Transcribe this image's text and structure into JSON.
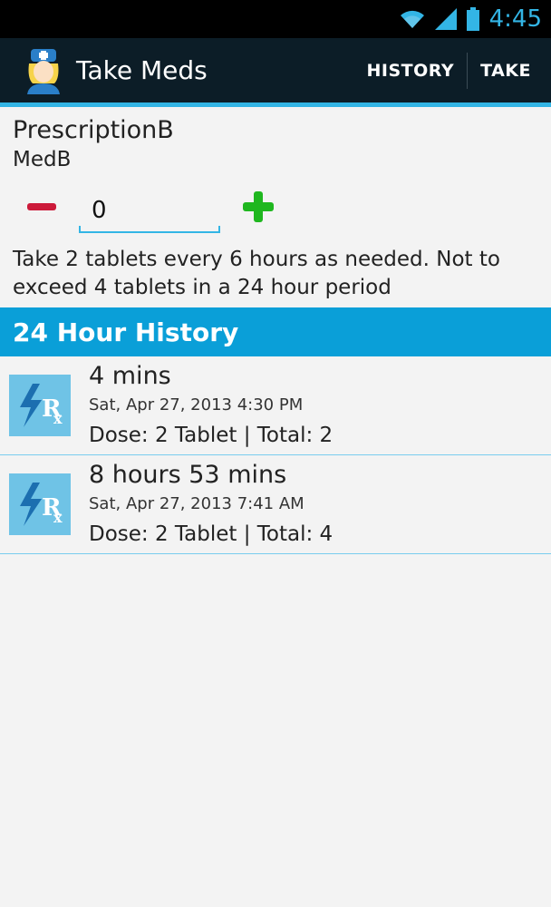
{
  "status_bar": {
    "time": "4:45"
  },
  "action_bar": {
    "title": "Take Meds",
    "history_label": "HISTORY",
    "take_label": "TAKE"
  },
  "prescription": {
    "name": "PrescriptionB",
    "medication": "MedB",
    "quantity_value": "0",
    "instructions": "Take 2 tablets every 6 hours as needed. Not to exceed 4 tablets in a 24 hour period"
  },
  "history": {
    "header": "24 Hour History",
    "items": [
      {
        "elapsed": "4 mins",
        "date": "Sat, Apr 27, 2013 4:30 PM",
        "dose": "Dose: 2 Tablet | Total: 2"
      },
      {
        "elapsed": "8 hours 53 mins",
        "date": "Sat, Apr 27, 2013 7:41 AM",
        "dose": "Dose: 2 Tablet | Total: 4"
      }
    ]
  },
  "colors": {
    "accent": "#33b5e5",
    "action_bar": "#0c1d27",
    "history_header": "#0a9fd8",
    "minus": "#cc1a3a",
    "plus": "#1fb71f"
  },
  "icons": [
    "wifi-icon",
    "signal-icon",
    "battery-icon",
    "nurse-app-icon",
    "minus-icon",
    "plus-icon",
    "rx-icon"
  ]
}
